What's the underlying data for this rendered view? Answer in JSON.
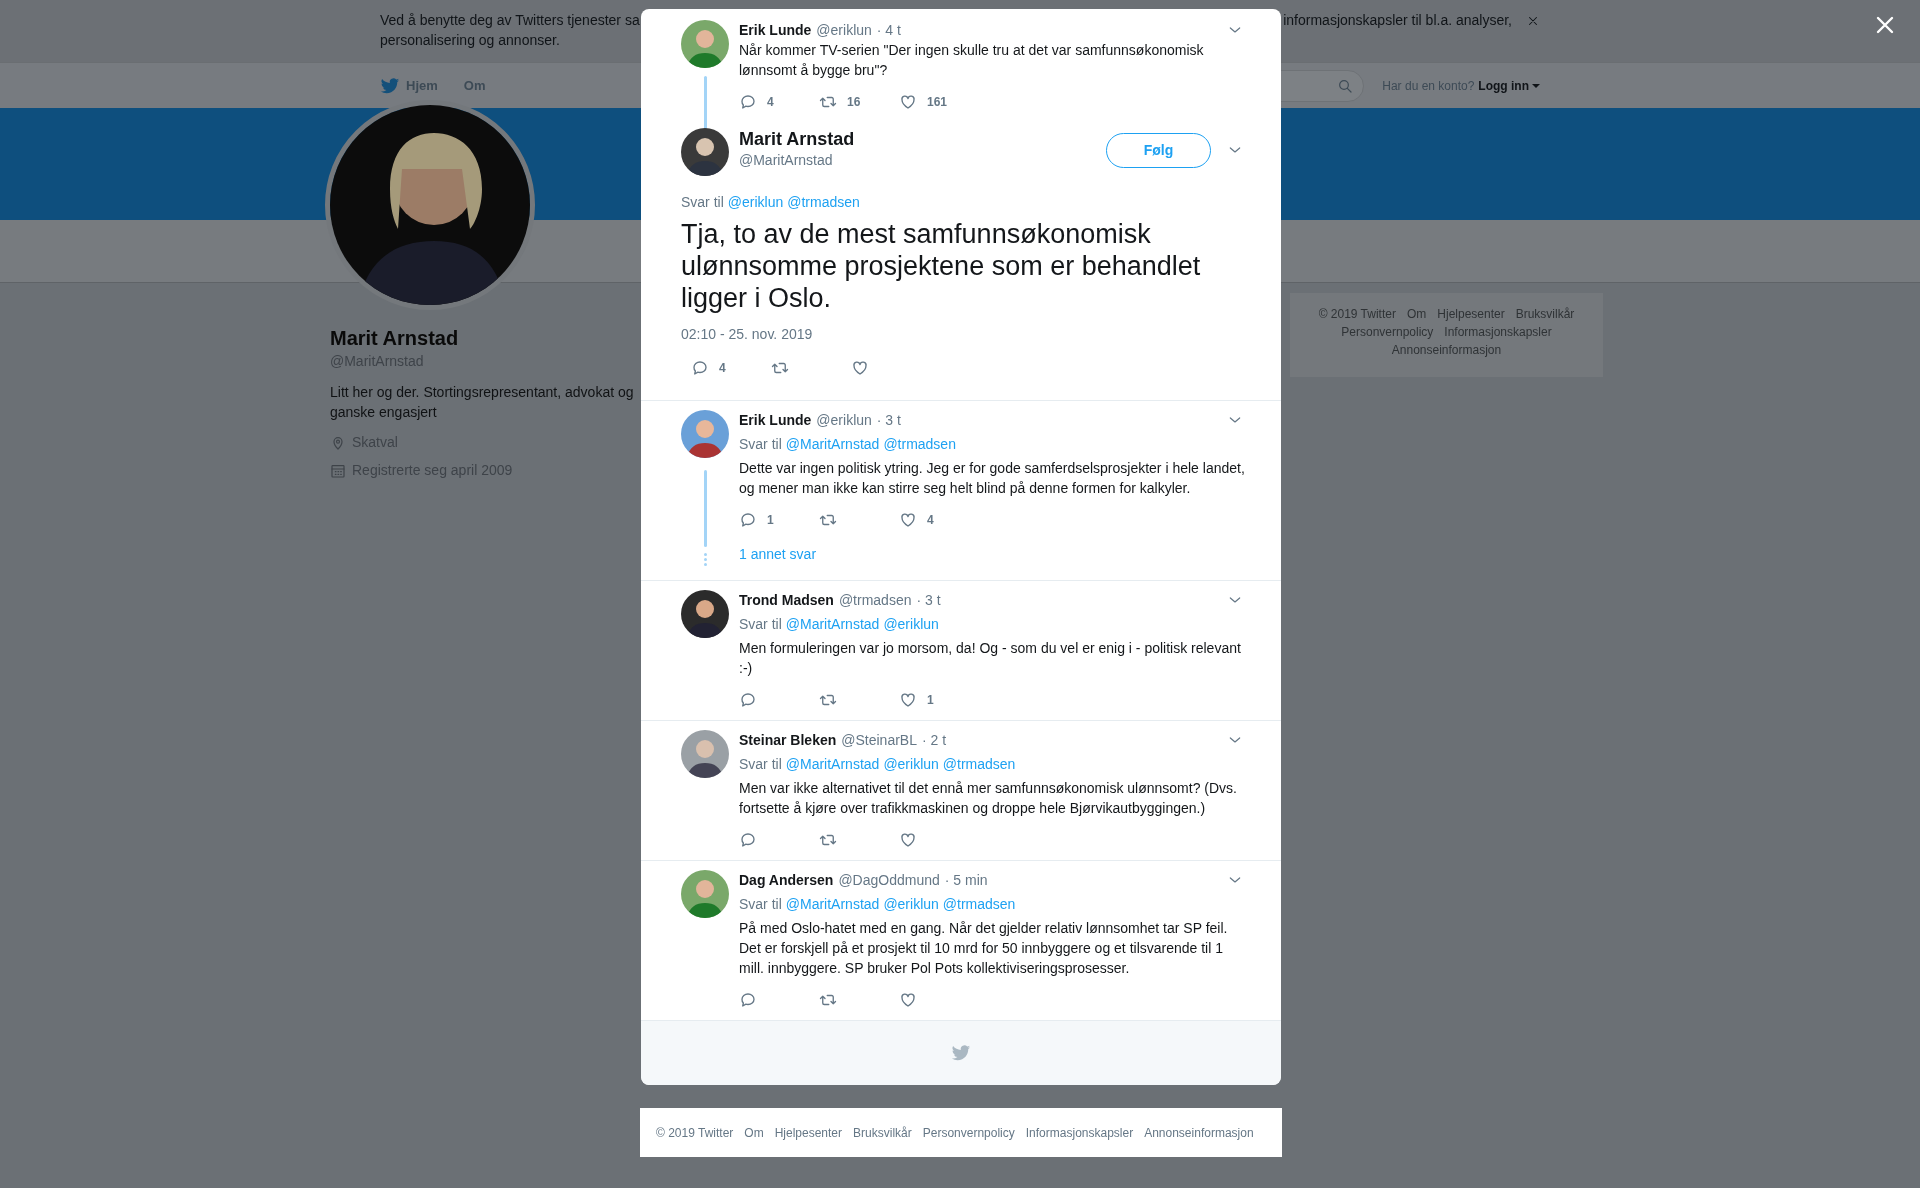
{
  "cookie_banner": {
    "text_start": "Ved å benytte deg av Twitters tjenester sa",
    "text_end": "informasjonskapsler til bl.a. analyser,",
    "text_line2": "personalisering og annonser."
  },
  "nav": {
    "items": [
      {
        "label": "Hjem",
        "kind": "home"
      },
      {
        "label": "Om",
        "kind": "plain"
      }
    ],
    "login_prompt": "Har du en konto?",
    "login_link": "Logg inn"
  },
  "profile": {
    "name": "Marit Arnstad",
    "handle": "@MaritArnstad",
    "bio": "Litt her og der. Stortingsrepresentant, advokat og ganske engasjert",
    "location": "Skatval",
    "joined": "Registrerte seg april 2009"
  },
  "side_footer": {
    "links": [
      "© 2019 Twitter",
      "Om",
      "Hjelpesenter",
      "Bruksvilkår",
      "Personvernpolicy",
      "Informasjonskapsler",
      "Annonseinformasjon"
    ]
  },
  "conversation": {
    "parent": {
      "name": "Erik Lunde",
      "handle": "@eriklun",
      "time": "· 4 t",
      "text": "Når kommer TV-serien \"Der ingen skulle tru at det var samfunnsøkonomisk lønnsomt å bygge bru\"?",
      "replies": "4",
      "retweets": "16",
      "likes": "161"
    },
    "main": {
      "name": "Marit Arnstad",
      "handle": "@MaritArnstad",
      "follow": "Følg",
      "reply_label": "Svar til",
      "reply_to": [
        "@eriklun",
        "@trmadsen"
      ],
      "text": "Tja, to av de mest samfunnsøkonomisk ulønnsomme prosjektene som er behandlet ligger i Oslo.",
      "timestamp": "02:10 - 25. nov. 2019",
      "replies": "4"
    },
    "replies": [
      {
        "name": "Erik Lunde",
        "handle": "@eriklun",
        "time": "· 3 t",
        "reply_label": "Svar til",
        "reply_to": [
          "@MaritArnstad",
          "@trmadsen"
        ],
        "text": "Dette var ingen politisk ytring. Jeg er for gode samferdselsprosjekter i hele landet, og mener man ikke kan stirre seg helt blind på denne formen for kalkyler.",
        "replies": "1",
        "likes": "4",
        "more": "1 annet svar"
      },
      {
        "name": "Trond Madsen",
        "handle": "@trmadsen",
        "time": "· 3 t",
        "reply_label": "Svar til",
        "reply_to": [
          "@MaritArnstad",
          "@eriklun"
        ],
        "text": "Men formuleringen var jo morsom, da! Og - som du vel er enig i - politisk relevant :-)",
        "likes": "1"
      },
      {
        "name": "Steinar Bleken",
        "handle": "@SteinarBL",
        "time": "· 2 t",
        "reply_label": "Svar til",
        "reply_to": [
          "@MaritArnstad",
          "@eriklun",
          "@trmadsen"
        ],
        "text": "Men var ikke alternativet til det ennå mer samfunnsøkonomisk ulønnsomt? (Dvs. fortsette å kjøre over trafikkmaskinen og droppe hele Bjørvikautbyggingen.)"
      },
      {
        "name": "Dag Andersen",
        "handle": "@DagOddmund",
        "time": "· 5 min",
        "reply_label": "Svar til",
        "reply_to": [
          "@MaritArnstad",
          "@eriklun",
          "@trmadsen"
        ],
        "text": "På med Oslo-hatet med en gang. Når det gjelder relativ lønnsomhet tar SP feil. Det er forskjell på et prosjekt til 10 mrd for 50 innbyggere og et tilsvarende til 1 mill. innbyggere. SP bruker Pol Pots kollektiviseringsprosesser."
      }
    ]
  },
  "footer": {
    "links": [
      "© 2019 Twitter",
      "Om",
      "Hjelpesenter",
      "Bruksvilkår",
      "Personvernpolicy",
      "Informasjonskapsler",
      "Annonseinformasjon"
    ]
  }
}
